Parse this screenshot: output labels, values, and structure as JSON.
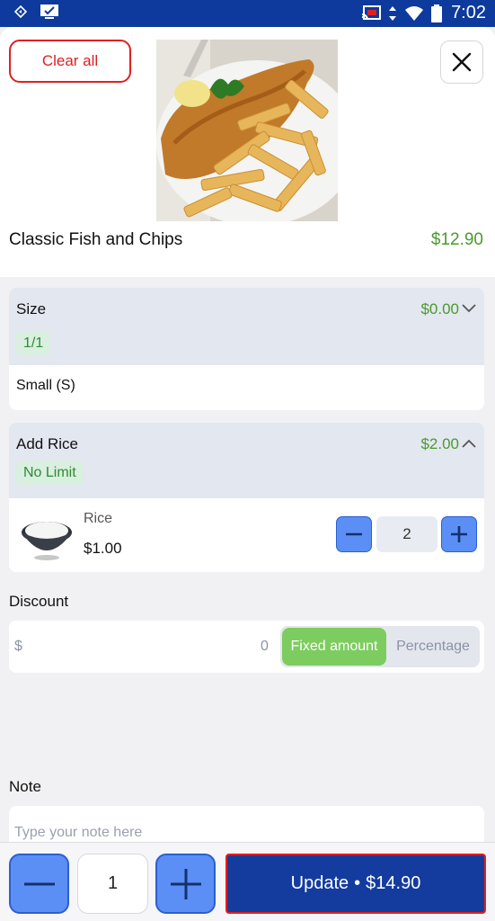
{
  "status_bar": {
    "time": "7:02"
  },
  "header": {
    "clear_label": "Clear all"
  },
  "product": {
    "name": "Classic Fish and Chips",
    "price": "$12.90"
  },
  "size_group": {
    "title": "Size",
    "price": "$0.00",
    "badge": "1/1",
    "selected_option": "Small (S)",
    "expanded": false
  },
  "rice_group": {
    "title": "Add Rice",
    "price": "$2.00",
    "badge": "No Limit",
    "expanded": true,
    "item": {
      "name": "Rice",
      "price": "$1.00",
      "quantity": "2"
    }
  },
  "discount": {
    "label": "Discount",
    "currency": "$",
    "amount": "0",
    "fixed_label": "Fixed amount",
    "percentage_label": "Percentage",
    "selected": "Fixed amount"
  },
  "note": {
    "label": "Note",
    "placeholder": "Type your note here"
  },
  "footer": {
    "quantity": "1",
    "update_label": "Update",
    "total": "$14.90"
  },
  "colors": {
    "brand_blue": "#143c9e",
    "accent_green": "#4b9a2c",
    "danger_red": "#e02020",
    "stepper_blue": "#5b8ff5"
  }
}
